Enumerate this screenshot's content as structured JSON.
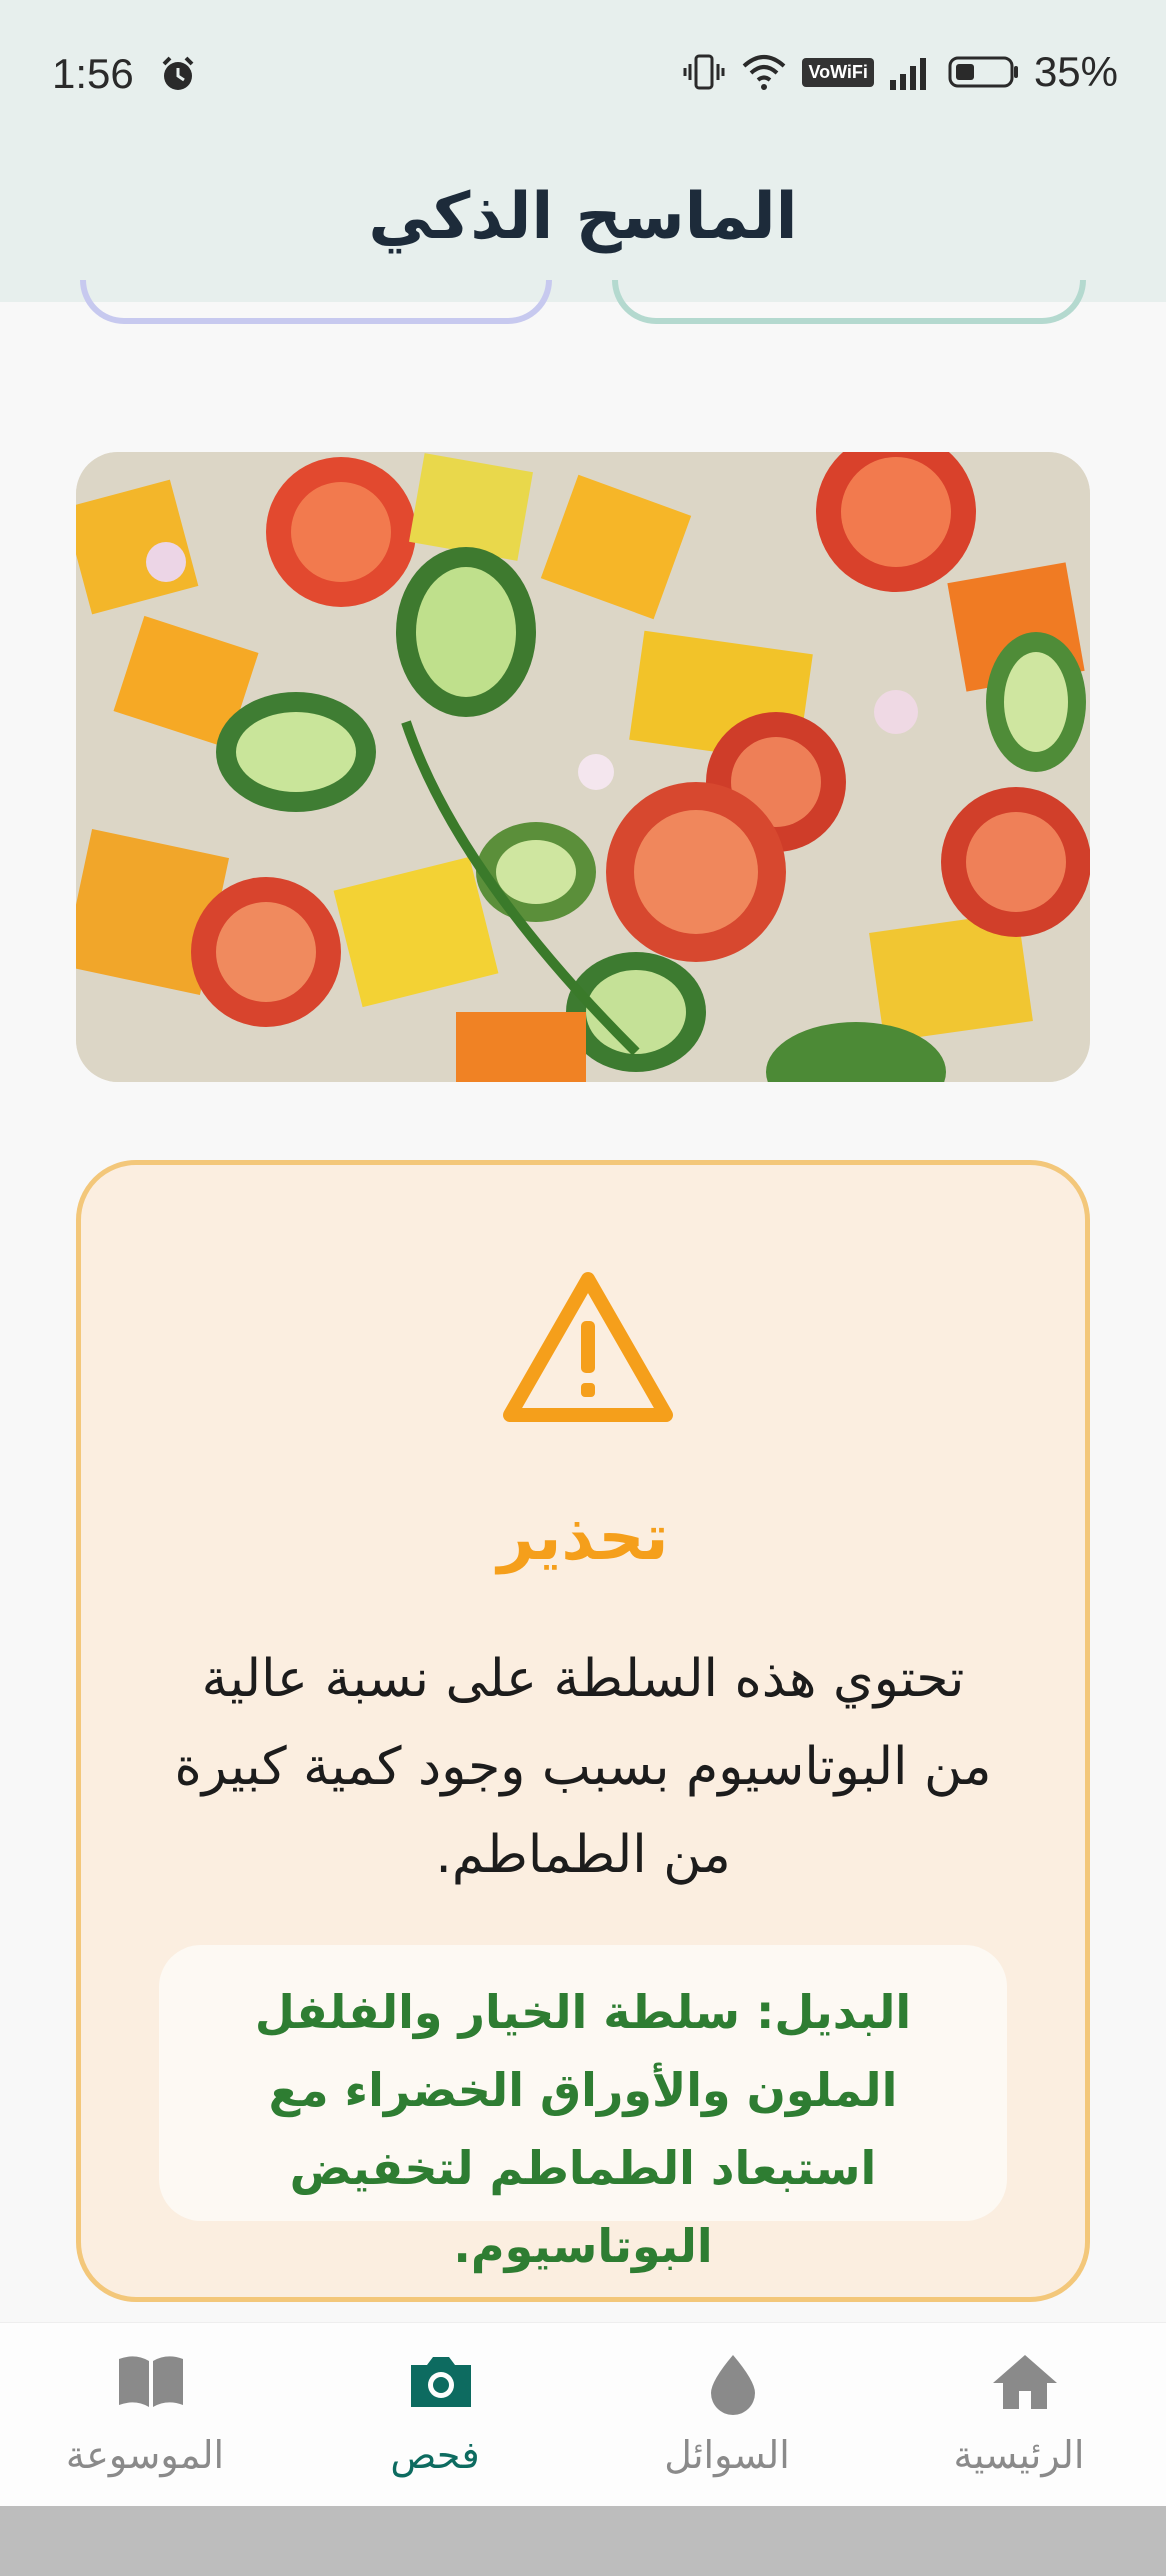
{
  "status": {
    "time": "1:56",
    "battery": "35%",
    "network_badge": "VoWiFi"
  },
  "header": {
    "title": "الماسح الذكي"
  },
  "image": {
    "description_icon": "salad-photo"
  },
  "warning": {
    "icon": "warning-triangle-icon",
    "title": "تحذير",
    "message": "تحتوي هذه السلطة على نسبة عالية من البوتاسيوم بسبب وجود كمية كبيرة من الطماطم.",
    "alternative": "البديل: سلطة الخيار والفلفل الملون والأوراق الخضراء مع استبعاد الطماطم لتخفيض البوتاسيوم."
  },
  "nav": {
    "items": [
      {
        "label": "الموسوعة",
        "icon": "book-icon",
        "active": false
      },
      {
        "label": "فحص",
        "icon": "camera-icon",
        "active": true
      },
      {
        "label": "السوائل",
        "icon": "drop-icon",
        "active": false
      },
      {
        "label": "الرئيسية",
        "icon": "home-icon",
        "active": false
      }
    ]
  },
  "colors": {
    "accent": "#0d6b60",
    "warning": "#f59f1b",
    "alternative": "#2e7d32"
  }
}
